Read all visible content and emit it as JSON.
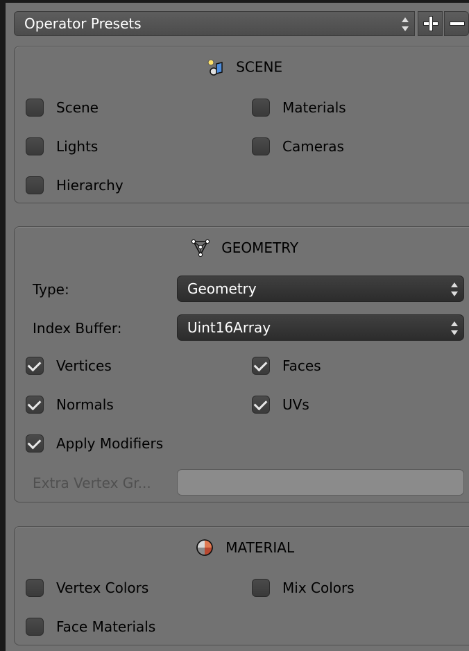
{
  "presets": {
    "label": "Operator Presets"
  },
  "scene": {
    "title": "SCENE",
    "options": [
      {
        "label": "Scene",
        "checked": false
      },
      {
        "label": "Materials",
        "checked": false
      },
      {
        "label": "Lights",
        "checked": false
      },
      {
        "label": "Cameras",
        "checked": false
      },
      {
        "label": "Hierarchy",
        "checked": false
      }
    ]
  },
  "geometry": {
    "title": "GEOMETRY",
    "type_label": "Type:",
    "type_value": "Geometry",
    "index_label": "Index Buffer:",
    "index_value": "Uint16Array",
    "options": [
      {
        "label": "Vertices",
        "checked": true
      },
      {
        "label": "Faces",
        "checked": true
      },
      {
        "label": "Normals",
        "checked": true
      },
      {
        "label": "UVs",
        "checked": true
      },
      {
        "label": "Apply Modifiers",
        "checked": true
      }
    ],
    "extra_label": "Extra Vertex Gr...",
    "extra_value": ""
  },
  "material": {
    "title": "MATERIAL",
    "options": [
      {
        "label": "Vertex Colors",
        "checked": false
      },
      {
        "label": "Mix Colors",
        "checked": false
      },
      {
        "label": "Face Materials",
        "checked": false
      }
    ]
  },
  "icons": {
    "scene": "scene-icon",
    "geometry": "mesh-icon",
    "material": "material-sphere-icon",
    "add": "plus-icon",
    "remove": "minus-icon"
  }
}
